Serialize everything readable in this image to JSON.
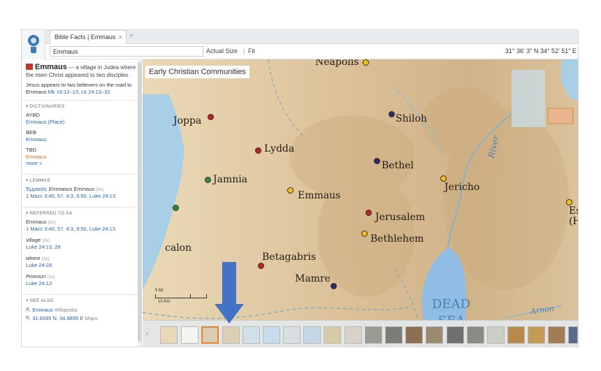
{
  "tab": {
    "title": "Bible Facts | Emmaus",
    "close": "×",
    "new": "+"
  },
  "toolbar": {
    "search_value": "Emmaus",
    "actual_size": "Actual Size",
    "fit": "Fit",
    "coords": "31° 36' 3\" N 34° 52' 51\" E"
  },
  "entry": {
    "title": "Emmaus",
    "summary": "— a village in Judea where the risen Christ appeared to two disciples.",
    "desc": "Jesus appears to two believers on the road to Emmaus",
    "refs": "Mk 16:12–13, Lk 24:13–32"
  },
  "dictionaries": {
    "heading": "DICTIONARIES",
    "items": [
      {
        "label": "AYBD",
        "sub": "Emmaus (Place)"
      },
      {
        "label": "BEB",
        "sub": "Emmaus"
      },
      {
        "label": "TBD",
        "sub": "Emmaus"
      }
    ],
    "more": "more »"
  },
  "lemmas": {
    "heading": "LEMMAS",
    "greek": "Ἐμμαοῦς",
    "translit": "Emmaous",
    "word": "Emmaus",
    "count": "(5x)",
    "refs": "1 Macc 3:40, 57, 4:3, 9:50, Luke 24:13"
  },
  "referred": {
    "heading": "REFERRED TO AS",
    "items": [
      {
        "label": "Emmaus",
        "count": "(5x)",
        "refs": "1 Macc 3:40, 57, 4:3, 9:50, Luke 24:13"
      },
      {
        "label": "village",
        "count": "(2x)",
        "refs": "Luke 24:13, 28"
      },
      {
        "label": "where",
        "count": "(1x)",
        "refs": "Luke 24:28"
      },
      {
        "label": "Pronoun",
        "count": "(1x)",
        "refs": "Luke 24:13"
      }
    ]
  },
  "see_also": {
    "heading": "SEE ALSO",
    "items": [
      {
        "label": "Emmaus",
        "source": "Wikipedia"
      },
      {
        "label": "31.8395 N, 34.9895 E",
        "source": "Maps"
      }
    ]
  },
  "map": {
    "label": "Early Christian Communities",
    "places": [
      "Neapolis",
      "Joppa",
      "Shiloh",
      "Lydda",
      "Bethel",
      "Jamnia",
      "Jericho",
      "Emmaus",
      "Jerusalem",
      "Bethlehem",
      "Esbus",
      "(Heshb",
      "calon",
      "Betagabris",
      "Mamre"
    ],
    "water": {
      "river": "River",
      "dead_sea_1": "DEAD",
      "dead_sea_2": "SEA",
      "arnon": "Arnon"
    },
    "scale": {
      "mi": "5 Mi",
      "km": "10 Km"
    }
  },
  "colors": {
    "red": "#b8232e",
    "yellow": "#f0c21b",
    "navy": "#2b2a6b",
    "green": "#2e8b3e",
    "accent": "#e8832a",
    "arrow": "#4472c4"
  }
}
